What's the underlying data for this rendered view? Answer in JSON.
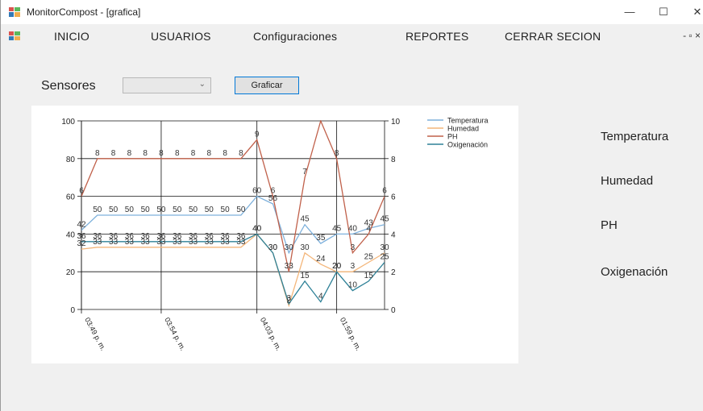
{
  "window": {
    "title": "MonitorCompost - [grafica]",
    "minimize": "—",
    "maximize": "☐",
    "close": "✕"
  },
  "menu": {
    "items": [
      "INICIO",
      "USUARIOS",
      "Configuraciones",
      "REPORTES",
      "CERRAR SECION"
    ],
    "mdi_controls": "- ▫ ×"
  },
  "controls": {
    "sensores_label": "Sensores",
    "sensor_select_value": "",
    "graficar_label": "Graficar"
  },
  "side_labels": [
    "Temperatura",
    "Humedad",
    "PH",
    "Oxigenación"
  ],
  "colors": {
    "temperatura": "#7eb1dc",
    "humedad": "#f4b67a",
    "ph": "#c0604a",
    "oxigenacion": "#2e8197"
  },
  "chart_data": {
    "type": "line",
    "x_labels": [
      "03:49 p. m.",
      "03:54 p. m.",
      "04:03 p. m.",
      "01:59 p. m."
    ],
    "y_left": {
      "min": 0,
      "max": 100,
      "ticks": [
        0,
        20,
        40,
        60,
        80,
        100
      ]
    },
    "y_right": {
      "min": 0,
      "max": 10,
      "ticks": [
        0,
        2,
        4,
        6,
        8,
        10
      ]
    },
    "grid": true,
    "legend_position": "top-right",
    "series": [
      {
        "name": "Temperatura",
        "axis": "left",
        "values": [
          42,
          50,
          50,
          50,
          50,
          50,
          50,
          50,
          50,
          50,
          50,
          60,
          56,
          30,
          45,
          35,
          40,
          40,
          43,
          45
        ],
        "labels": [
          "42",
          "50",
          "50",
          "50",
          "50",
          "50",
          "50",
          "50",
          "50",
          "50",
          "50",
          "60",
          "56",
          "30",
          "45",
          "35",
          "45",
          "40",
          "43",
          "45"
        ]
      },
      {
        "name": "Humedad",
        "axis": "left",
        "values": [
          32,
          33,
          33,
          33,
          33,
          33,
          33,
          33,
          33,
          33,
          33,
          40,
          30,
          2,
          30,
          24,
          20,
          20,
          25,
          30
        ],
        "labels": [
          "32",
          "33",
          "33",
          "33",
          "33",
          "33",
          "33",
          "33",
          "33",
          "33",
          "33",
          "40",
          "30",
          "2",
          "30",
          "24",
          "20",
          "3",
          "25",
          "30"
        ]
      },
      {
        "name": "PH",
        "axis": "right",
        "values": [
          6,
          8,
          8,
          8,
          8,
          8,
          8,
          8,
          8,
          8,
          8,
          9,
          6,
          2,
          7,
          10,
          8,
          3,
          4,
          6
        ],
        "labels": [
          "6",
          "8",
          "8",
          "8",
          "8",
          "8",
          "8",
          "8",
          "8",
          "8",
          "8",
          "9",
          "6",
          "33",
          "7",
          "",
          "8",
          "3",
          "4",
          "6"
        ]
      },
      {
        "name": "Oxigenación",
        "axis": "left",
        "values": [
          36,
          36,
          36,
          36,
          36,
          36,
          36,
          36,
          36,
          36,
          36,
          40,
          30,
          3,
          15,
          4,
          20,
          10,
          15,
          25
        ],
        "labels": [
          "36",
          "36",
          "36",
          "36",
          "36",
          "36",
          "36",
          "36",
          "36",
          "36",
          "36",
          "40",
          "30",
          "3",
          "15",
          "4",
          "20",
          "10",
          "15",
          "25"
        ]
      }
    ]
  }
}
